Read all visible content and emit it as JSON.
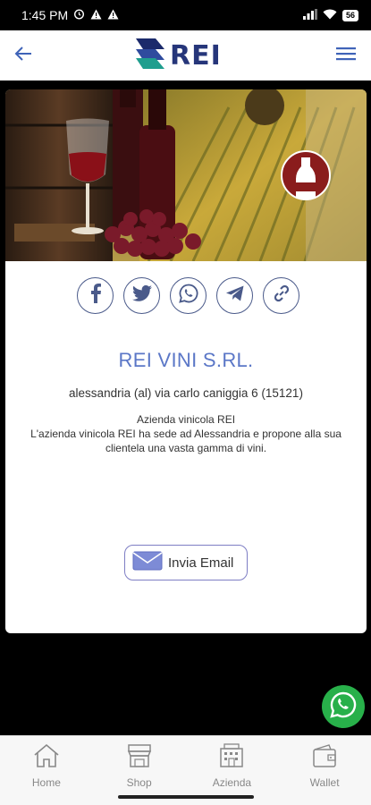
{
  "status": {
    "time": "1:45 PM",
    "battery": "56"
  },
  "header": {
    "logo_text": "REI",
    "back_icon": "arrow-left-icon",
    "menu_icon": "hamburger-menu-icon",
    "accent_color": "#3f63b8"
  },
  "social": [
    "facebook-icon",
    "twitter-icon",
    "whatsapp-icon",
    "telegram-icon",
    "link-icon"
  ],
  "company": {
    "name": "REI VINI S.RL.",
    "address": "alessandria (al) via carlo caniggia 6 (15121)",
    "description_title": "Azienda vinicola REI",
    "description": "L'azienda vinicola REI ha sede ad Alessandria e propone alla sua clientela una vasta gamma di vini."
  },
  "email_button": {
    "label": "Invia Email"
  },
  "bottom_nav": {
    "items": [
      {
        "label": "Home",
        "icon": "home-icon"
      },
      {
        "label": "Shop",
        "icon": "shop-icon"
      },
      {
        "label": "Azienda",
        "icon": "company-icon"
      },
      {
        "label": "Wallet",
        "icon": "wallet-icon"
      }
    ]
  },
  "colors": {
    "title": "#5b77c7",
    "whatsapp": "#28b04a",
    "nav_label": "#888888"
  }
}
